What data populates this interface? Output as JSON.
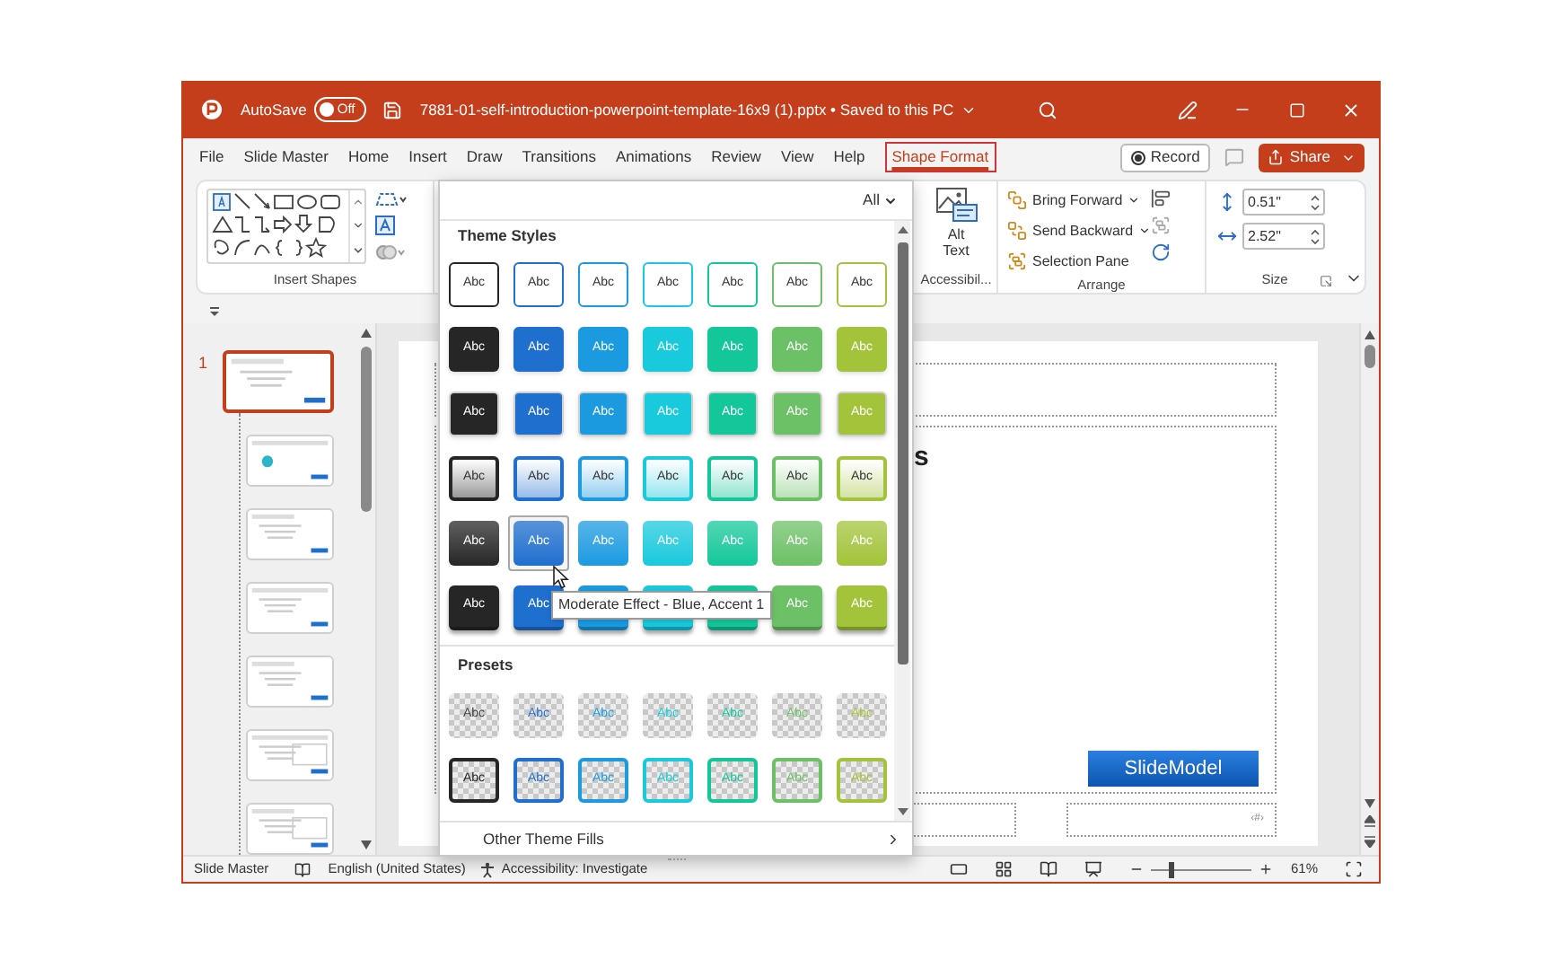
{
  "window": {
    "autosave_label": "AutoSave",
    "autosave": {
      "on": false,
      "label": "Off"
    },
    "title": "7881-01-self-introduction-powerpoint-template-16x9 (1).pptx • Saved to this PC"
  },
  "tabs": [
    {
      "label": "File",
      "selected": false
    },
    {
      "label": "Slide Master",
      "selected": false
    },
    {
      "label": "Home",
      "selected": false
    },
    {
      "label": "Insert",
      "selected": false
    },
    {
      "label": "Draw",
      "selected": false
    },
    {
      "label": "Transitions",
      "selected": false
    },
    {
      "label": "Animations",
      "selected": false
    },
    {
      "label": "Review",
      "selected": false
    },
    {
      "label": "View",
      "selected": false
    },
    {
      "label": "Help",
      "selected": false
    },
    {
      "label": "Shape Format",
      "selected": true
    }
  ],
  "record_button": "Record",
  "share_button": "Share",
  "ribbon": {
    "insert_shapes": {
      "label": "Insert Shapes"
    },
    "accessibility": {
      "button": "Alt Text",
      "label": "Accessibil..."
    },
    "arrange": {
      "items": [
        "Bring Forward",
        "Send Backward",
        "Selection Pane"
      ],
      "label": "Arrange"
    },
    "size": {
      "height": "0.51\"",
      "width": "2.52\"",
      "label": "Size"
    }
  },
  "gallery": {
    "filter": "All",
    "sections": [
      {
        "heading": "Theme Styles",
        "rows": [
          {
            "kind": "outline",
            "swatches": [
              {
                "label": "Abc",
                "color": "#262626",
                "selected": false
              },
              {
                "label": "Abc",
                "color": "#1f6fcf",
                "selected": false
              },
              {
                "label": "Abc",
                "color": "#1b9ae0",
                "selected": false
              },
              {
                "label": "Abc",
                "color": "#19c9dc",
                "selected": false
              },
              {
                "label": "Abc",
                "color": "#14c79a",
                "selected": false
              },
              {
                "label": "Abc",
                "color": "#6cc066",
                "selected": false
              },
              {
                "label": "Abc",
                "color": "#a3c33a",
                "selected": false
              }
            ]
          },
          {
            "kind": "solid",
            "swatches": [
              {
                "label": "Abc",
                "color": "#262626",
                "selected": false
              },
              {
                "label": "Abc",
                "color": "#1f6fcf",
                "selected": false
              },
              {
                "label": "Abc",
                "color": "#1b9ae0",
                "selected": false
              },
              {
                "label": "Abc",
                "color": "#19c9dc",
                "selected": false
              },
              {
                "label": "Abc",
                "color": "#14c79a",
                "selected": false
              },
              {
                "label": "Abc",
                "color": "#6cc066",
                "selected": false
              },
              {
                "label": "Abc",
                "color": "#a3c33a",
                "selected": false
              }
            ]
          },
          {
            "kind": "solid-edge",
            "swatches": [
              {
                "label": "Abc",
                "color": "#262626",
                "selected": false
              },
              {
                "label": "Abc",
                "color": "#1f6fcf",
                "selected": false
              },
              {
                "label": "Abc",
                "color": "#1b9ae0",
                "selected": false
              },
              {
                "label": "Abc",
                "color": "#19c9dc",
                "selected": false
              },
              {
                "label": "Abc",
                "color": "#14c79a",
                "selected": false
              },
              {
                "label": "Abc",
                "color": "#6cc066",
                "selected": false
              },
              {
                "label": "Abc",
                "color": "#a3c33a",
                "selected": false
              }
            ]
          },
          {
            "kind": "light",
            "swatches": [
              {
                "label": "Abc",
                "color": "#262626",
                "selected": false
              },
              {
                "label": "Abc",
                "color": "#1f6fcf",
                "selected": false
              },
              {
                "label": "Abc",
                "color": "#1b9ae0",
                "selected": false
              },
              {
                "label": "Abc",
                "color": "#19c9dc",
                "selected": false
              },
              {
                "label": "Abc",
                "color": "#14c79a",
                "selected": false
              },
              {
                "label": "Abc",
                "color": "#6cc066",
                "selected": false
              },
              {
                "label": "Abc",
                "color": "#a3c33a",
                "selected": false
              }
            ]
          },
          {
            "kind": "moderate",
            "swatches": [
              {
                "label": "Abc",
                "color": "#262626",
                "selected": false
              },
              {
                "label": "Abc",
                "color": "#1f6fcf",
                "selected": true
              },
              {
                "label": "Abc",
                "color": "#1b9ae0",
                "selected": false
              },
              {
                "label": "Abc",
                "color": "#19c9dc",
                "selected": false
              },
              {
                "label": "Abc",
                "color": "#14c79a",
                "selected": false
              },
              {
                "label": "Abc",
                "color": "#6cc066",
                "selected": false
              },
              {
                "label": "Abc",
                "color": "#a3c33a",
                "selected": false
              }
            ]
          },
          {
            "kind": "intense",
            "swatches": [
              {
                "label": "Abc",
                "color": "#262626",
                "selected": false
              },
              {
                "label": "Abc",
                "color": "#1f6fcf",
                "selected": false
              },
              {
                "color": "#1b9ae0",
                "selected": false
              },
              {
                "color": "#19c9dc",
                "selected": false
              },
              {
                "color": "#14c79a",
                "selected": false
              },
              {
                "label": "Abc",
                "color": "#6cc066",
                "selected": false
              },
              {
                "label": "Abc",
                "color": "#a3c33a",
                "selected": false
              }
            ]
          }
        ]
      },
      {
        "heading": "Presets",
        "rows": [
          {
            "kind": "preset-plain",
            "swatches": [
              {
                "label": "Abc",
                "color": "#404040",
                "selected": false
              },
              {
                "label": "Abc",
                "color": "#1f6fcf",
                "selected": false
              },
              {
                "label": "Abc",
                "color": "#1b9ae0",
                "selected": false
              },
              {
                "label": "Abc",
                "color": "#19c9dc",
                "selected": false
              },
              {
                "label": "Abc",
                "color": "#14c79a",
                "selected": false
              },
              {
                "label": "Abc",
                "color": "#6cc066",
                "selected": false
              },
              {
                "label": "Abc",
                "color": "#a3c33a",
                "selected": false
              }
            ]
          },
          {
            "kind": "preset-outline",
            "swatches": [
              {
                "label": "Abc",
                "color": "#262626",
                "selected": false
              },
              {
                "label": "Abc",
                "color": "#1f6fcf",
                "selected": false
              },
              {
                "label": "Abc",
                "color": "#1b9ae0",
                "selected": false
              },
              {
                "label": "Abc",
                "color": "#19c9dc",
                "selected": false
              },
              {
                "label": "Abc",
                "color": "#14c79a",
                "selected": false
              },
              {
                "label": "Abc",
                "color": "#6cc066",
                "selected": false
              },
              {
                "label": "Abc",
                "color": "#a3c33a",
                "selected": false
              }
            ]
          }
        ]
      }
    ],
    "footer": "Other Theme Fills",
    "tooltip": "Moderate Effect - Blue, Accent 1"
  },
  "slides": [
    {
      "kind": "master",
      "number": "1",
      "selected": true
    },
    {
      "kind": "layout",
      "selected": false
    },
    {
      "kind": "layout",
      "selected": false
    },
    {
      "kind": "layout",
      "selected": false
    },
    {
      "kind": "layout",
      "selected": false
    },
    {
      "kind": "layout",
      "selected": false
    },
    {
      "kind": "layout",
      "selected": false
    }
  ],
  "slide": {
    "title_fragment": "s",
    "logo": "SlideModel",
    "slide_number": "‹#›"
  },
  "status_bar": {
    "view": "Slide Master",
    "language": "English (United States)",
    "accessibility": "Accessibility: Investigate",
    "zoom": {
      "level": 0.2,
      "reading": "61%"
    }
  }
}
